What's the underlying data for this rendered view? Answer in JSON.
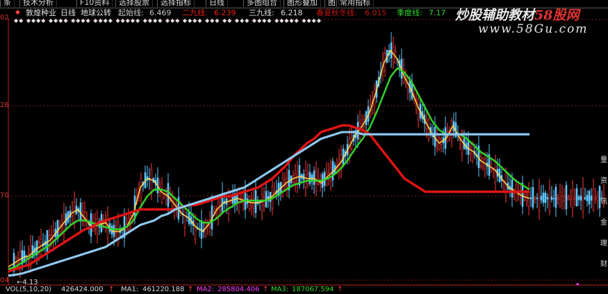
{
  "toolbar": {
    "items": [
      "条",
      "技术分析",
      "F10资料",
      "选择股票",
      "选择指标",
      "日线",
      "多图组合",
      "图形叠加",
      "图",
      "常用指标"
    ]
  },
  "indicator_header": {
    "stock_name": "敦煌种业",
    "period": "日线",
    "title": "地球公转",
    "start_label": "起始线:",
    "start_value": "6.469",
    "line2_label": "二九线:",
    "line2_value": "6.239",
    "line3_label": "三九线:",
    "line3_value": "6.218",
    "line4_label": "季度线:",
    "line4_value": "7.17",
    "hidden_label": "春夏秋冬线:",
    "hidden_value": "6.015"
  },
  "marks_text": "◆◆ ◆◆◆◆ ◆◆◆◆ ◆◆◆◆ ◆◆◆◆ ◆◆◆◆◆ ◆◆◆◆ ◆◆◆ ◆◆◆◆ ◆◆◆ ◆◆ ◆◆◆ ◆◆◆◆ ◆◆◆◆◆ ◆◆◆◆",
  "y_axis": {
    "labels": [
      "02",
      "26",
      "70",
      "04"
    ]
  },
  "low_marker": "4.13",
  "volume_row": {
    "label": "VOL(5,10,20)",
    "vol_value": "426424.000",
    "ma1_label": "MA1:",
    "ma1_value": "461220.188",
    "ma2_label": "MA2:",
    "ma2_value": "285804.406",
    "ma3_label": "MA3:",
    "ma3_value": "187067.594"
  },
  "watermark": {
    "brand_prefix": "炒股辅助教材",
    "brand_suffix": "58股网",
    "url": "www.58Gu.com"
  },
  "right_side_text": [
    "量",
    "资",
    "讯",
    "金",
    "理",
    "财"
  ],
  "colors": {
    "price_candle_up": "#ff3b3b",
    "price_candle_down": "#5ec8ff",
    "yellow_line": "#ffd84a",
    "green_line": "#31d32a",
    "red_line": "#e01414",
    "blue_line": "#8fc8ef",
    "axis": "#c02020"
  },
  "chart_data": {
    "type": "line",
    "x": [
      0,
      10,
      20,
      30,
      40,
      50,
      60,
      70,
      80,
      90,
      100,
      110,
      120,
      130,
      140,
      150,
      160,
      170,
      180,
      190,
      200,
      210,
      220,
      230,
      240,
      250,
      260,
      270,
      280,
      290,
      300,
      310,
      320,
      330,
      340,
      350,
      360,
      370,
      380,
      390,
      400,
      410,
      420,
      430,
      440,
      450,
      460,
      470,
      480,
      490,
      500,
      510,
      520,
      530,
      540,
      550,
      560,
      570,
      580,
      590,
      600,
      610,
      620,
      630,
      640,
      650,
      660,
      670,
      680,
      690,
      700,
      710,
      720,
      730,
      740,
      750,
      760,
      770,
      780,
      790,
      800,
      810,
      820,
      830,
      840,
      850,
      860
    ],
    "series": [
      {
        "name": "起始线",
        "values": [
          4.3,
          4.4,
          4.5,
          4.55,
          4.7,
          4.8,
          4.9,
          5.1,
          5.3,
          5.5,
          5.6,
          5.4,
          5.2,
          5.25,
          5.3,
          5.1,
          5.1,
          5.2,
          5.5,
          6.1,
          6.3,
          6.25,
          6.0,
          5.9,
          5.7,
          5.5,
          5.4,
          5.2,
          5.1,
          5.3,
          5.6,
          5.75,
          5.8,
          5.85,
          5.8,
          5.75,
          5.75,
          5.8,
          5.9,
          6.05,
          6.2,
          6.3,
          6.35,
          6.3,
          6.3,
          6.2,
          6.35,
          6.5,
          6.7,
          7.0,
          7.3,
          7.5,
          7.8,
          8.3,
          8.9,
          9.2,
          9.0,
          8.6,
          8.3,
          7.9,
          7.6,
          7.3,
          7.1,
          7.2,
          7.5,
          7.2,
          7.0,
          6.9,
          6.7,
          6.6,
          6.5,
          6.3,
          6.1,
          6.0,
          5.9,
          5.85
        ]
      },
      {
        "name": "二九线",
        "values": [
          4.25,
          4.3,
          4.4,
          4.5,
          4.6,
          4.7,
          4.8,
          4.95,
          5.1,
          5.25,
          5.35,
          5.35,
          5.3,
          5.25,
          5.2,
          5.15,
          5.15,
          5.2,
          5.35,
          5.65,
          5.9,
          6.05,
          6.05,
          6.0,
          5.85,
          5.7,
          5.55,
          5.4,
          5.3,
          5.3,
          5.4,
          5.55,
          5.65,
          5.75,
          5.8,
          5.8,
          5.8,
          5.8,
          5.85,
          5.95,
          6.05,
          6.15,
          6.2,
          6.25,
          6.25,
          6.25,
          6.3,
          6.4,
          6.55,
          6.75,
          7.0,
          7.2,
          7.45,
          7.8,
          8.2,
          8.6,
          8.8,
          8.7,
          8.5,
          8.2,
          7.9,
          7.6,
          7.4,
          7.3,
          7.3,
          7.3,
          7.2,
          7.05,
          6.9,
          6.8,
          6.7,
          6.55,
          6.4,
          6.25,
          6.15,
          6.05
        ]
      },
      {
        "name": "三九线",
        "values": [
          4.2,
          4.25,
          4.3,
          4.35,
          4.45,
          4.55,
          4.65,
          4.75,
          4.85,
          4.95,
          5.05,
          5.15,
          5.2,
          5.3,
          5.35,
          5.4,
          5.45,
          5.5,
          5.55,
          5.6,
          5.6,
          5.6,
          5.6,
          5.6,
          5.6,
          5.65,
          5.7,
          5.7,
          5.75,
          5.8,
          5.85,
          5.9,
          5.9,
          5.95,
          6.0,
          6.05,
          6.1,
          6.2,
          6.3,
          6.45,
          6.6,
          6.8,
          6.95,
          7.1,
          7.2,
          7.35,
          7.4,
          7.45,
          7.5,
          7.5,
          7.45,
          7.4,
          7.3,
          7.1,
          6.9,
          6.7,
          6.5,
          6.3,
          6.2,
          6.1,
          6.0,
          6.0,
          6.0,
          6.0,
          6.0,
          6.0,
          6.0,
          6.0,
          6.0,
          6.0,
          6.0,
          6.0,
          6.0,
          6.0,
          6.0,
          6.0
        ]
      },
      {
        "name": "季度线",
        "values": [
          4.1,
          4.12,
          4.15,
          4.2,
          4.25,
          4.3,
          4.35,
          4.4,
          4.45,
          4.5,
          4.55,
          4.6,
          4.65,
          4.7,
          4.75,
          4.85,
          4.95,
          5.05,
          5.15,
          5.25,
          5.3,
          5.35,
          5.45,
          5.5,
          5.6,
          5.65,
          5.7,
          5.75,
          5.8,
          5.85,
          5.9,
          5.95,
          6.0,
          6.05,
          6.1,
          6.2,
          6.3,
          6.4,
          6.5,
          6.6,
          6.7,
          6.8,
          6.9,
          7.0,
          7.1,
          7.2,
          7.25,
          7.3,
          7.35,
          7.35,
          7.35,
          7.3,
          7.3,
          7.3,
          7.3,
          7.3,
          7.3,
          7.3,
          7.3,
          7.3,
          7.3,
          7.3,
          7.3,
          7.3,
          7.3,
          7.3,
          7.3,
          7.3,
          7.3,
          7.3,
          7.3,
          7.3,
          7.3,
          7.3,
          7.3,
          7.3
        ]
      }
    ]
  }
}
